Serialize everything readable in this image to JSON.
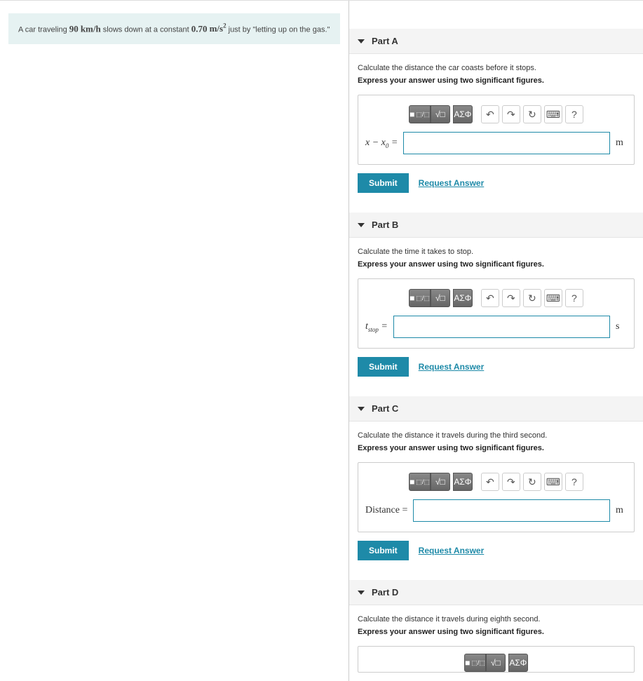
{
  "prompt": {
    "prefix": "A car traveling ",
    "speed": "90",
    "speed_unit": "km/h",
    "mid": " slows down at a constant ",
    "accel": "0.70",
    "accel_unit_base": "m/s",
    "accel_unit_sup": "2",
    "suffix": " just by \"letting up on the gas.\""
  },
  "toolbar": {
    "template_label": "■",
    "sqrt_label": "√□",
    "greek_label": "ΑΣΦ",
    "undo_title": "Undo",
    "redo_title": "Redo",
    "reset_title": "Reset",
    "keyboard_title": "Keyboard",
    "help_label": "?"
  },
  "buttons": {
    "submit": "Submit",
    "request_answer": "Request Answer"
  },
  "parts": {
    "a": {
      "title": "Part A",
      "instr": "Calculate the distance the car coasts before it stops.",
      "instr_bold": "Express your answer using two significant figures.",
      "var_html": "x − x0 =",
      "unit": "m"
    },
    "b": {
      "title": "Part B",
      "instr": "Calculate the time it takes to stop.",
      "instr_bold": "Express your answer using two significant figures.",
      "var_text": "t",
      "var_sub": "stop",
      "unit": "s"
    },
    "c": {
      "title": "Part C",
      "instr": "Calculate the distance it travels during the third second.",
      "instr_bold": "Express your answer using two significant figures.",
      "var_text": "Distance =",
      "unit": "m"
    },
    "d": {
      "title": "Part D",
      "instr": "Calculate the distance it travels during eighth second.",
      "instr_bold": "Express your answer using two significant figures."
    }
  }
}
